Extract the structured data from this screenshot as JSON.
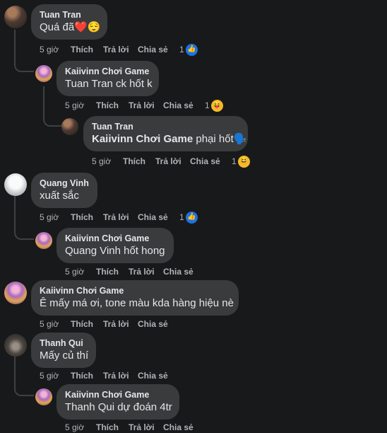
{
  "actions": {
    "like": "Thích",
    "reply": "Trả lời",
    "share": "Chia sẻ"
  },
  "comments": [
    {
      "author": "Tuan Tran",
      "text": "Quá đã❤️😌",
      "time": "5 giờ",
      "reactions": {
        "count": "1",
        "icon": "👍"
      }
    },
    {
      "author": "Kaiivinn Chơi Game",
      "text": "Tuan Tran ck hốt k",
      "time": "5 giờ",
      "reactions": {
        "count": "1",
        "icon": "😝"
      }
    },
    {
      "author": "Tuan Tran",
      "mention": "Kaiivinn Chơi Game",
      "text": " phại hốt🗣️",
      "time": "5 giờ",
      "reactions": {
        "count": "1",
        "icon": "😆"
      }
    },
    {
      "author": "Quang Vinh",
      "text": "xuất sắc",
      "time": "5 giờ",
      "reactions": {
        "count": "1",
        "icon": "👍"
      }
    },
    {
      "author": "Kaiivinn Chơi Game",
      "text": "Quang Vinh hốt hong",
      "time": "5 giờ"
    },
    {
      "author": "Kaiivinn Chơi Game",
      "text": "Ê mấy má ơi, tone màu kda hàng hiệu nè",
      "time": "5 giờ"
    },
    {
      "author": "Thanh Qui",
      "text": "Mấy củ thí",
      "time": "5 giờ"
    },
    {
      "author": "Kaiivinn Chơi Game",
      "text": "Thanh Qui dự đoán 4tr",
      "time": "5 giờ"
    }
  ]
}
